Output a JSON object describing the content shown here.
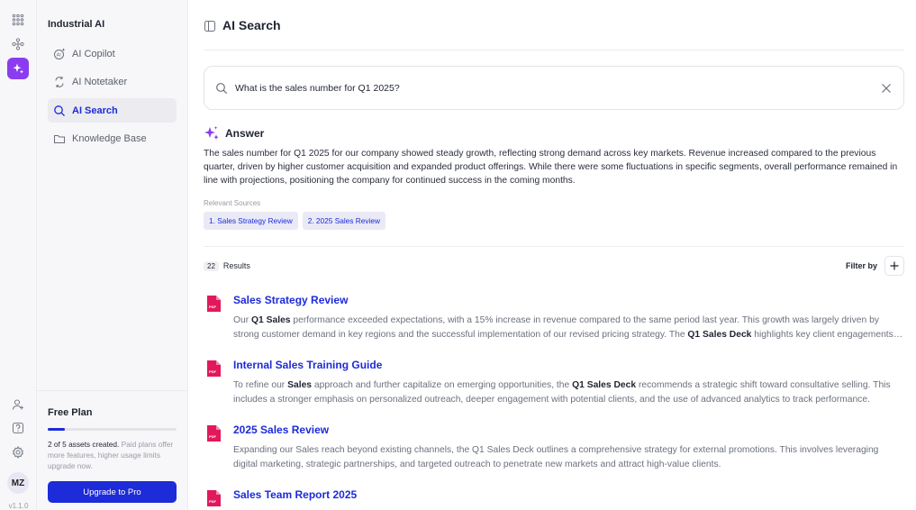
{
  "app": {
    "brand": "Industrial AI",
    "version": "v1.1.0"
  },
  "rail": {
    "items": [
      {
        "name": "apps-grid-icon"
      },
      {
        "name": "workflow-icon"
      },
      {
        "name": "ai-sparkle-icon",
        "active": true
      }
    ],
    "bottom": [
      {
        "name": "add-user-icon"
      },
      {
        "name": "help-icon"
      },
      {
        "name": "settings-icon"
      }
    ],
    "user_initials": "MZ"
  },
  "sidebar": {
    "items": [
      {
        "label": "AI Copilot",
        "icon": "ai-copilot-icon"
      },
      {
        "label": "AI Notetaker",
        "icon": "notetaker-icon"
      },
      {
        "label": "AI Search",
        "icon": "ai-search-icon",
        "active": true
      },
      {
        "label": "Knowledge Base",
        "icon": "folder-icon"
      }
    ]
  },
  "plan": {
    "title": "Free Plan",
    "used": 2,
    "limit": 5,
    "progress": 0.13,
    "usage_text": "2 of 5 assets created.",
    "upsell_text": "Paid plans offer more features, higher usage limits upgrade now.",
    "upgrade_label": "Upgrade to Pro"
  },
  "page": {
    "title": "AI Search"
  },
  "search": {
    "query": "What is the sales number for Q1 2025?"
  },
  "answer": {
    "label": "Answer",
    "text": "The sales number for Q1 2025 for our company showed steady growth, reflecting strong demand across key markets. Revenue increased compared to the previous quarter, driven by higher customer acquisition and expanded product offerings. While there were some fluctuations in specific segments, overall performance remained in line with projections, positioning the company for continued success in the coming months.",
    "sources_label": "Relevant Sources",
    "sources": [
      "1.  Sales Strategy Review",
      "2.  2025 Sales Review"
    ]
  },
  "results": {
    "count": "22",
    "label": "Results",
    "filter_label": "Filter by",
    "items": [
      {
        "title": "Sales Strategy Review",
        "snippet": [
          {
            "t": "Our "
          },
          {
            "t": "Q1 Sales",
            "k": true
          },
          {
            "t": " performance exceeded expectations, with a 15% increase in revenue compared to the same period last year. This growth was largely driven by strong customer demand in key regions and the successful implementation of our revised pricing strategy. The "
          },
          {
            "t": "Q1 Sales Deck",
            "k": true
          },
          {
            "t": " highlights key client engagements and new market opportunities."
          }
        ]
      },
      {
        "title": "Internal Sales Training Guide",
        "snippet": [
          {
            "t": "To refine our "
          },
          {
            "t": "Sales",
            "k": true
          },
          {
            "t": " approach and further capitalize on emerging opportunities, the "
          },
          {
            "t": "Q1 Sales Deck",
            "k": true
          },
          {
            "t": " recommends a strategic shift toward consultative selling. This includes a stronger emphasis on personalized outreach, deeper engagement with potential clients, and the use of advanced analytics to track performance."
          }
        ]
      },
      {
        "title": "2025 Sales Review",
        "snippet": [
          {
            "t": "Expanding our Sales reach beyond existing channels, the Q1 Sales Deck outlines a comprehensive strategy for external promotions. This involves leveraging digital marketing, strategic partnerships, and targeted outreach to penetrate new markets and attract high-value clients."
          }
        ]
      },
      {
        "title": "Sales Team Report 2025",
        "snippet": []
      }
    ]
  },
  "colors": {
    "accent": "#1d2bd8",
    "brand_purple": "#8b3cf0",
    "pdf_red": "#e1195a"
  }
}
